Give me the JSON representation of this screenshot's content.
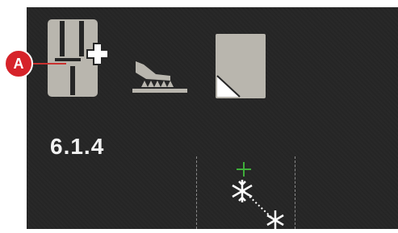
{
  "screen": {
    "stitch_number": "6.1.4"
  },
  "toolbar": {
    "presser_foot_icon": "presser-foot-plus-icon",
    "feed_dogs_icon": "feed-dogs-icon",
    "stabilizer_icon": "stabilizer-icon"
  },
  "callout": {
    "label": "A",
    "color": "#d6232a"
  },
  "colors": {
    "screen_background": "#262626",
    "icon_fill": "#b9b6ae",
    "center_mark": "#3fae3a"
  }
}
